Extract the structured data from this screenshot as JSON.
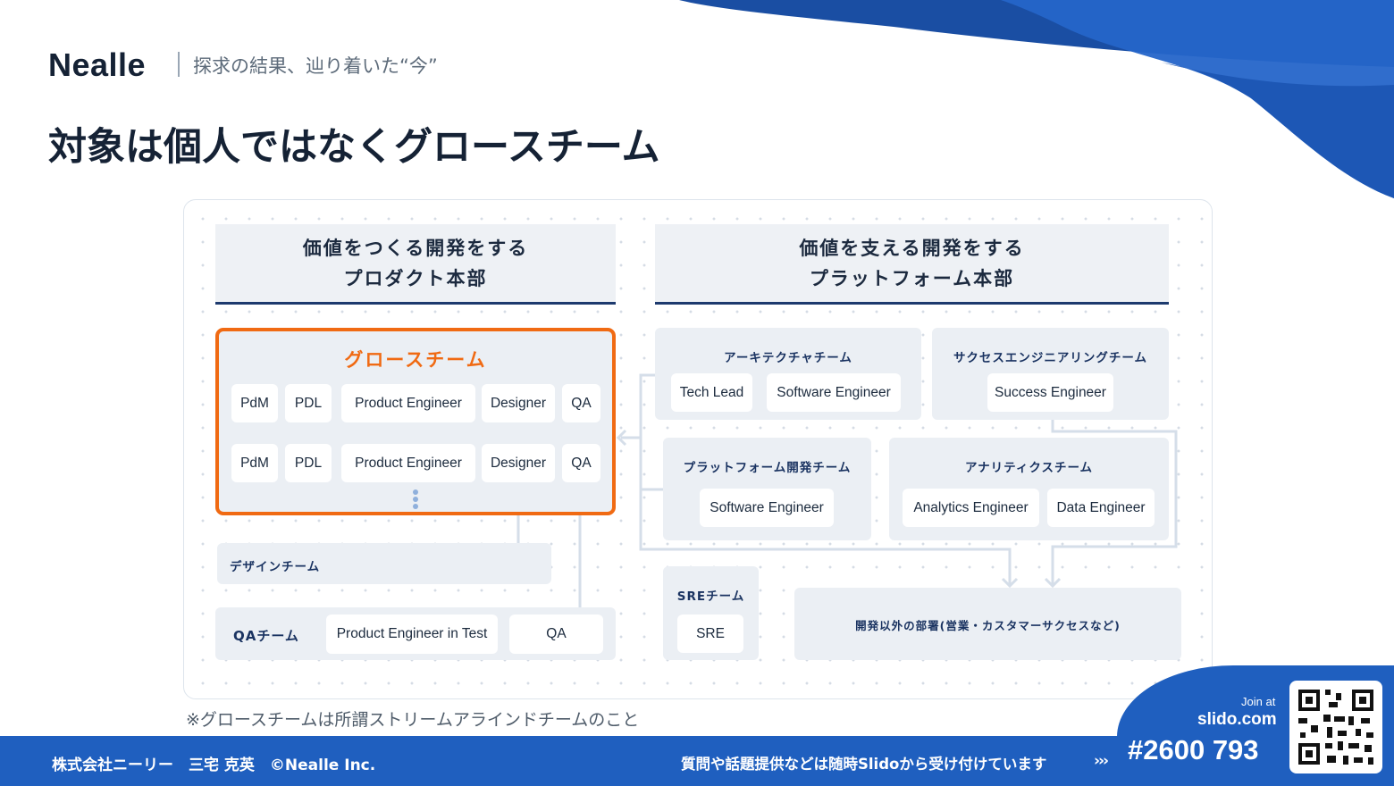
{
  "header": {
    "logo": "Nealle",
    "tagline": "探求の結果、辿り着いた“今”",
    "title": "対象は個人ではなくグロースチーム"
  },
  "diagram": {
    "product_dept": {
      "line1": "価値をつくる開発をする",
      "line2": "プロダクト本部"
    },
    "platform_dept": {
      "line1": "価値を支える開発をする",
      "line2": "プラットフォーム本部"
    },
    "growth_team": {
      "title": "グロースチーム",
      "rows": [
        [
          "PdM",
          "PDL",
          "Product Engineer",
          "Designer",
          "QA"
        ],
        [
          "PdM",
          "PDL",
          "Product Engineer",
          "Designer",
          "QA"
        ]
      ],
      "more_icon": "vertical-ellipsis-icon"
    },
    "design_team": {
      "title": "デザインチーム"
    },
    "qa_team": {
      "title": "QAチーム",
      "members": [
        "Product Engineer in Test",
        "QA"
      ]
    },
    "architecture_team": {
      "title": "アーキテクチャチーム",
      "members": [
        "Tech Lead",
        "Software Engineer"
      ]
    },
    "success_team": {
      "title": "サクセスエンジニアリングチーム",
      "members": [
        "Success Engineer"
      ]
    },
    "platform_dev_team": {
      "title": "プラットフォーム開発チーム",
      "members": [
        "Software Engineer"
      ]
    },
    "analytics_team": {
      "title": "アナリティクスチーム",
      "members": [
        "Analytics Engineer",
        "Data Engineer"
      ]
    },
    "sre_team": {
      "title": "SREチーム",
      "members": [
        "SRE"
      ]
    },
    "other_depts": {
      "title": "開発以外の部署(営業・カスタマーサクセスなど)"
    }
  },
  "footnote": "※グロースチームは所謂ストリームアラインドチームのこと",
  "footer": {
    "left": "株式会社ニーリー　三宅 克英　©Nealle Inc.",
    "middle": "質問や話題提供などは随時Slidoから受け付けています",
    "chevron": "›››"
  },
  "slido": {
    "join_label": "Join at",
    "url": "slido.com",
    "code": "#2600 793",
    "qr_icon": "qr-code-icon"
  },
  "colors": {
    "brand_blue": "#1f5fbf",
    "growth_orange": "#f06a13",
    "navy_text": "#1a3361",
    "box_gray": "#ebeff4"
  }
}
